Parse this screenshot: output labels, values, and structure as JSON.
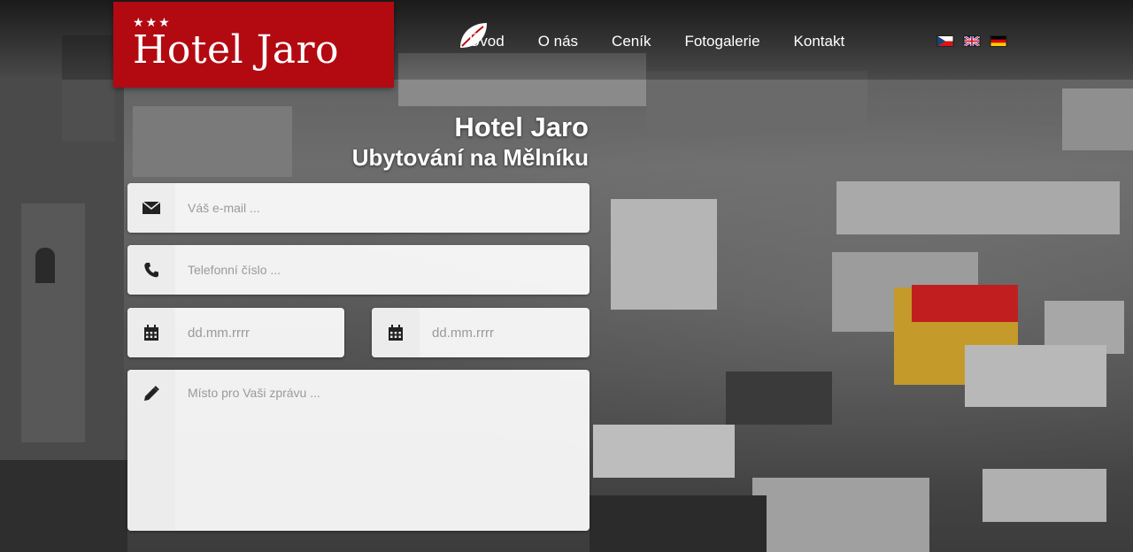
{
  "logo": {
    "stars": "★★★",
    "name": "Hotel Jaro"
  },
  "nav": {
    "items": [
      {
        "label": "Úvod"
      },
      {
        "label": "O nás"
      },
      {
        "label": "Ceník"
      },
      {
        "label": "Fotogalerie"
      },
      {
        "label": "Kontakt"
      }
    ]
  },
  "flags": [
    "czech-flag-icon",
    "uk-flag-icon",
    "german-flag-icon"
  ],
  "headline": {
    "title": "Hotel Jaro",
    "subtitle": "Ubytování na Mělníku"
  },
  "form": {
    "email": {
      "placeholder": "Váš e-mail ..."
    },
    "phone": {
      "placeholder": "Telefonní číslo ..."
    },
    "date_from": {
      "placeholder": "dd.mm.rrrr"
    },
    "date_to": {
      "placeholder": "dd.mm.rrrr"
    },
    "message": {
      "placeholder": "Místo pro Vaši zprávu ..."
    }
  },
  "colors": {
    "brand": "#b30a12",
    "text_light": "#ffffff"
  }
}
